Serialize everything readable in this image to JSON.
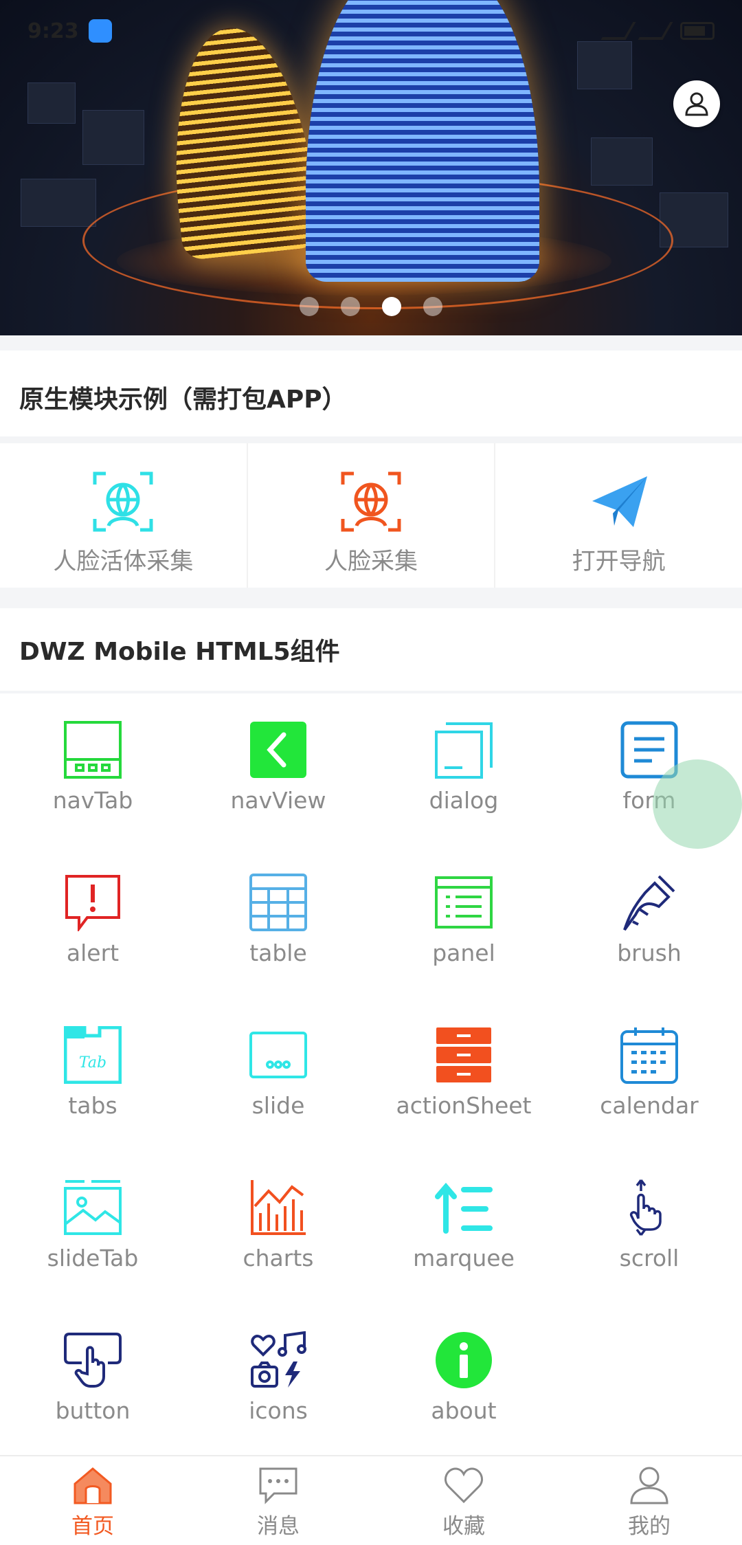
{
  "status_bar": {
    "time": "9:23"
  },
  "banner": {
    "slide_count": 4,
    "active_slide": 3
  },
  "native_section": {
    "title": "原生模块示例（需打包APP）",
    "items": [
      {
        "label": "人脸活体采集",
        "icon": "face-scan-icon",
        "color": "#2fe0e6"
      },
      {
        "label": "人脸采集",
        "icon": "face-capture-icon",
        "color": "#f0551f"
      },
      {
        "label": "打开导航",
        "icon": "paper-plane-icon",
        "color": "#3aa1f0"
      }
    ]
  },
  "dwz_section": {
    "title": "DWZ Mobile HTML5组件",
    "items": [
      {
        "label": "navTab",
        "icon": "navtab-icon",
        "color": "#25d93c"
      },
      {
        "label": "navView",
        "icon": "chevron-left-icon",
        "color": "#22e63a"
      },
      {
        "label": "dialog",
        "icon": "dialog-icon",
        "color": "#2fd6e6"
      },
      {
        "label": "form",
        "icon": "form-icon",
        "color": "#1f8ad6"
      },
      {
        "label": "alert",
        "icon": "alert-icon",
        "color": "#e02424"
      },
      {
        "label": "table",
        "icon": "table-icon",
        "color": "#56b0e6"
      },
      {
        "label": "panel",
        "icon": "panel-icon",
        "color": "#2fd643"
      },
      {
        "label": "brush",
        "icon": "brush-icon",
        "color": "#1f2a7a"
      },
      {
        "label": "tabs",
        "icon": "tabs-icon",
        "color": "#2fe6e6"
      },
      {
        "label": "slide",
        "icon": "slide-icon",
        "color": "#2fe6e6"
      },
      {
        "label": "actionSheet",
        "icon": "action-sheet-icon",
        "color": "#f2501f"
      },
      {
        "label": "calendar",
        "icon": "calendar-icon",
        "color": "#1f8ad6"
      },
      {
        "label": "slideTab",
        "icon": "slide-tab-icon",
        "color": "#2fe6e6"
      },
      {
        "label": "charts",
        "icon": "bar-chart-icon",
        "color": "#f2501f"
      },
      {
        "label": "marquee",
        "icon": "marquee-icon",
        "color": "#2fe6e6"
      },
      {
        "label": "scroll",
        "icon": "scroll-hand-icon",
        "color": "#1f2a7a"
      },
      {
        "label": "button",
        "icon": "button-press-icon",
        "color": "#1f2a7a"
      },
      {
        "label": "icons",
        "icon": "icons-collage-icon",
        "color": "#1f2a7a"
      },
      {
        "label": "about",
        "icon": "info-icon",
        "color": "#22e63a"
      }
    ]
  },
  "tabbar": {
    "active": "home",
    "items": [
      {
        "label": "首页",
        "icon": "home-icon"
      },
      {
        "label": "消息",
        "icon": "message-icon"
      },
      {
        "label": "收藏",
        "icon": "heart-icon"
      },
      {
        "label": "我的",
        "icon": "user-icon"
      }
    ]
  },
  "colors": {
    "accent": "#f25a22",
    "label": "#8a8a8a",
    "title": "#2a2a2a"
  }
}
